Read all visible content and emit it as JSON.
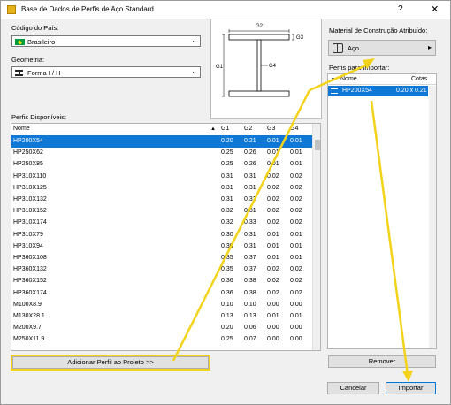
{
  "window": {
    "title": "Base de Dados de Perfis de Aço Standard",
    "help_label": "?",
    "close_label": "✕"
  },
  "left": {
    "country_label": "Código do País:",
    "country_value": "Brasileiro",
    "geometry_label": "Geometria:",
    "geometry_value": "Forma I / H",
    "profiles_label": "Perfis Disponíveis:"
  },
  "diagram": {
    "labels": {
      "g2": "G2",
      "g3": "G3",
      "g1": "G1",
      "g4": "G4"
    }
  },
  "table": {
    "headers": {
      "name": "Nome",
      "sort": "▲",
      "g1": "G1",
      "g2": "G2",
      "g3": "G3",
      "g4": "G4"
    },
    "rows": [
      [
        "HP200X54",
        "0.20",
        "0.21",
        "0.01",
        "0.01"
      ],
      [
        "HP250X62",
        "0.25",
        "0.26",
        "0.01",
        "0.01"
      ],
      [
        "HP250X85",
        "0.25",
        "0.26",
        "0.01",
        "0.01"
      ],
      [
        "HP310X110",
        "0.31",
        "0.31",
        "0.02",
        "0.02"
      ],
      [
        "HP310X125",
        "0.31",
        "0.31",
        "0.02",
        "0.02"
      ],
      [
        "HP310X132",
        "0.31",
        "0.31",
        "0.02",
        "0.02"
      ],
      [
        "HP310X152",
        "0.32",
        "0.31",
        "0.02",
        "0.02"
      ],
      [
        "HP310X174",
        "0.32",
        "0.33",
        "0.02",
        "0.02"
      ],
      [
        "HP310X79",
        "0.30",
        "0.31",
        "0.01",
        "0.01"
      ],
      [
        "HP310X94",
        "0.30",
        "0.31",
        "0.01",
        "0.01"
      ],
      [
        "HP360X108",
        "0.35",
        "0.37",
        "0.01",
        "0.01"
      ],
      [
        "HP360X132",
        "0.35",
        "0.37",
        "0.02",
        "0.02"
      ],
      [
        "HP360X152",
        "0.36",
        "0.38",
        "0.02",
        "0.02"
      ],
      [
        "HP360X174",
        "0.36",
        "0.38",
        "0.02",
        "0.02"
      ],
      [
        "M100X8.9",
        "0.10",
        "0.10",
        "0.00",
        "0.00"
      ],
      [
        "M130X28.1",
        "0.13",
        "0.13",
        "0.01",
        "0.01"
      ],
      [
        "M200X9.7",
        "0.20",
        "0.06",
        "0.00",
        "0.00"
      ],
      [
        "M250X11.9",
        "0.25",
        "0.07",
        "0.00",
        "0.00"
      ]
    ],
    "selected_index": 0
  },
  "buttons": {
    "add": "Adicionar Perfil ao Projeto >>",
    "remove": "Remover",
    "cancel": "Cancelar",
    "import": "Importar"
  },
  "right": {
    "material_label": "Material de Construção Atribuído:",
    "material_value": "Aço",
    "import_label": "Perfis para Importar:",
    "import_headers": {
      "name": "Nome",
      "dims": "Cotas"
    },
    "import_rows": [
      {
        "name": "HP200X54",
        "dims": "0.20 x 0.21"
      }
    ]
  },
  "colors": {
    "selection": "#0f78d7",
    "annotation": "#f3d31a"
  },
  "icons": [
    "warning-icon",
    "brazil-flag-icon",
    "i-beam-icon",
    "chevron-down-icon",
    "material-icon",
    "arrow-right-icon",
    "sort-up-icon",
    "dropdown-arrow-icon",
    "i-beam-row-icon"
  ]
}
